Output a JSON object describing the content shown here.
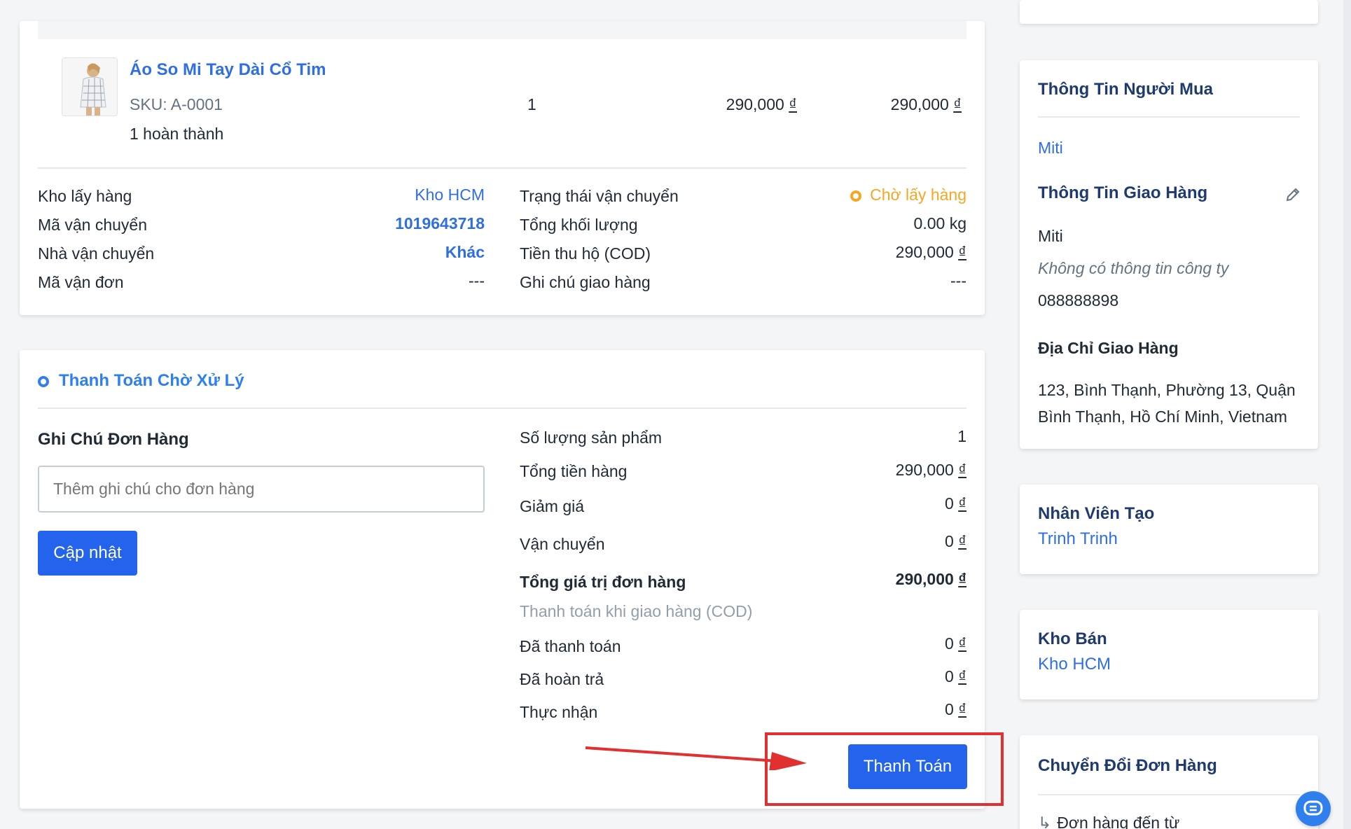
{
  "product": {
    "name": "Áo So Mi Tay Dài Cổ Tim",
    "sku": "SKU: A-0001",
    "fulfilled": "1 hoàn thành",
    "quantity": "1",
    "unit_price": "290,000",
    "total_price": "290,000",
    "currency": "₫"
  },
  "shipping": {
    "left": [
      {
        "label": "Kho lấy hàng",
        "value": "Kho HCM"
      },
      {
        "label": "Mã vận chuyển",
        "value": "1019643718"
      },
      {
        "label": "Nhà vận chuyển",
        "value": "Khác"
      },
      {
        "label": "Mã vận đơn",
        "value": "---"
      }
    ],
    "right": [
      {
        "label": "Trạng thái vận chuyển",
        "value": "Chờ lấy hàng"
      },
      {
        "label": "Tổng khối lượng",
        "value": "0.00 kg"
      },
      {
        "label": "Tiền thu hộ (COD)",
        "value": "290,000"
      },
      {
        "label": "Ghi chú giao hàng",
        "value": "---"
      }
    ]
  },
  "payment": {
    "status": "Thanh Toán Chờ Xử Lý",
    "note_title": "Ghi Chú Đơn Hàng",
    "note_placeholder": "Thêm ghi chú cho đơn hàng",
    "update_button": "Cập nhật",
    "summary": [
      {
        "label": "Số lượng sản phẩm",
        "value": "1"
      },
      {
        "label": "Tổng tiền hàng",
        "value": "290,000"
      },
      {
        "label": "Giảm giá",
        "value": "0"
      },
      {
        "label": "Vận chuyển",
        "value": "0"
      },
      {
        "label": "Tổng giá trị đơn hàng",
        "value": "290,000"
      },
      {
        "label": "Thanh toán khi giao hàng (COD)",
        "value": ""
      },
      {
        "label": "Đã thanh toán",
        "value": "0"
      },
      {
        "label": "Đã hoàn trả",
        "value": "0"
      },
      {
        "label": "Thực nhận",
        "value": "0"
      }
    ],
    "pay_button": "Thanh Toán"
  },
  "sidebar": {
    "buyer_title": "Thông Tin Người Mua",
    "buyer_name": "Miti",
    "delivery_title": "Thông Tin Giao Hàng",
    "delivery_name": "Miti",
    "company": "Không có thông tin công ty",
    "phone": "088888898",
    "address_title": "Địa Chỉ Giao Hàng",
    "address_line1": "123, Bình Thạnh, Phường 13, Quận",
    "address_line2": "Bình Thạnh, Hồ Chí Minh, Vietnam",
    "staff_title": "Nhân Viên Tạo",
    "staff_name": "Trinh Trinh",
    "warehouse_title": "Kho Bán",
    "warehouse_name": "Kho HCM",
    "convert_title": "Chuyển Đổi Đơn Hàng",
    "convert_item": "Đơn hàng đến từ"
  },
  "colors": {
    "primary": "#2463eb",
    "link": "#2f6fe0",
    "warning": "#f5a623",
    "annotation": "#e03030"
  }
}
